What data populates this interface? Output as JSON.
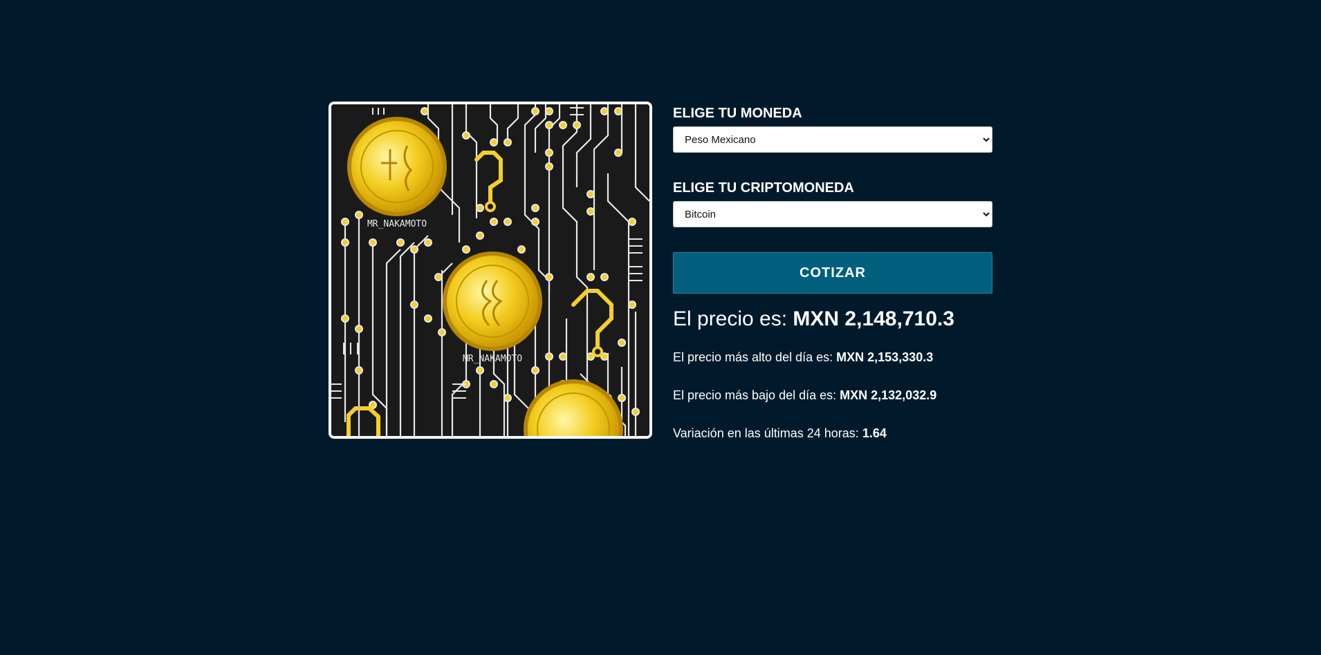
{
  "form": {
    "currency_label": "ELIGE TU MONEDA",
    "currency_selected": "Peso Mexicano",
    "crypto_label": "ELIGE TU CRIPTOMONEDA",
    "crypto_selected": "Bitcoin",
    "submit_label": "COTIZAR"
  },
  "hero": {
    "coin_text": "MR_NAKAMOTO"
  },
  "result": {
    "price_label": "El precio es: ",
    "price_value": "MXN 2,148,710.3",
    "high_label": "El precio más alto del día es: ",
    "high_value": "MXN 2,153,330.3",
    "low_label": "El precio más bajo del día es: ",
    "low_value": "MXN 2,132,032.9",
    "change_label": "Variación en las últimas 24 horas: ",
    "change_value": "1.64"
  },
  "colors": {
    "background": "#001a2b",
    "button": "#025f7d",
    "coin": "#f2c318"
  }
}
